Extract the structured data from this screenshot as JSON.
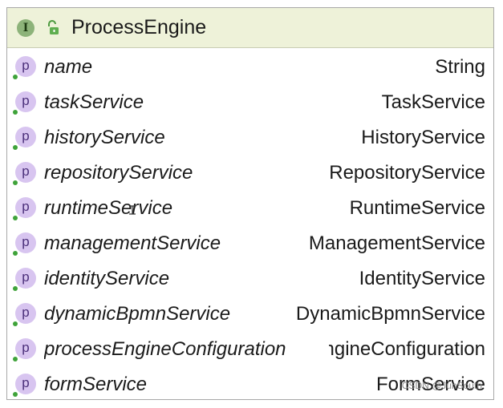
{
  "header": {
    "kind_icon_letter": "I",
    "title": "ProcessEngine"
  },
  "badge_letter": "p",
  "fields": [
    {
      "name": "name",
      "type": "String"
    },
    {
      "name": "taskService",
      "type": "TaskService"
    },
    {
      "name": "historyService",
      "type": "HistoryService"
    },
    {
      "name": "repositoryService",
      "type": "RepositoryService"
    },
    {
      "name": "runtimeService",
      "type": "RuntimeService"
    },
    {
      "name": "managementService",
      "type": "ManagementService"
    },
    {
      "name": "identityService",
      "type": "IdentityService"
    },
    {
      "name": "dynamicBpmnService",
      "type": "DynamicBpmnService"
    },
    {
      "name": "processEngineConfiguration",
      "type": "ProcessEngineConfiguration"
    },
    {
      "name": "formService",
      "type": "FormService"
    }
  ],
  "watermark": "CSDN @JunSouth",
  "colors": {
    "header_bg": "#eef2d9",
    "interface_badge": "#8db37a",
    "property_badge": "#d8c5f0",
    "public_dot": "#3fa33a"
  }
}
